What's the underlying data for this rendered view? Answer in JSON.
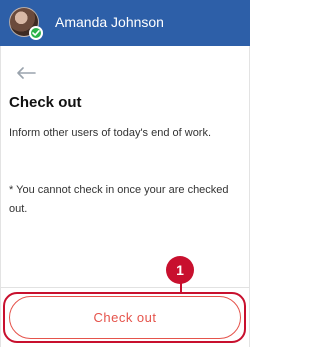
{
  "header": {
    "user_name": "Amanda Johnson",
    "status": "online",
    "icons": {
      "avatar": "user-avatar",
      "status": "check-icon",
      "back": "arrow-left-icon"
    }
  },
  "page": {
    "title": "Check out",
    "description": "Inform other users of today's end of work.",
    "note": "* You cannot check in once your are checked out."
  },
  "actions": {
    "checkout_label": "Check out"
  },
  "annotation": {
    "step_number": "1"
  },
  "colors": {
    "header_bg": "#2d5fa8",
    "accent_red": "#e5534b",
    "annotation_red": "#c8102e",
    "status_green": "#2bb34a"
  }
}
